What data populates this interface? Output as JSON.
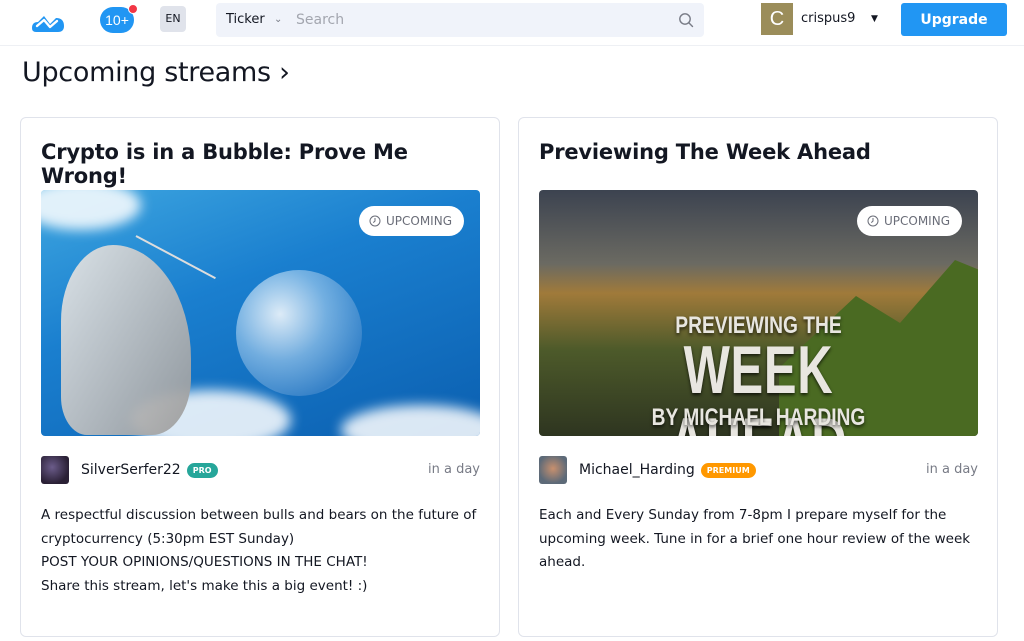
{
  "header": {
    "logo": "tradingview-cloud-logo",
    "notifications": {
      "count_label": "10+",
      "has_unread_dot": true
    },
    "language": "EN",
    "search": {
      "scope_label": "Ticker",
      "placeholder": "Search",
      "value": ""
    },
    "user": {
      "avatar_letter": "C",
      "username": "crispus9",
      "avatar_color": "#9b8d5a"
    },
    "upgrade_label": "Upgrade",
    "accent_color": "#2196f3"
  },
  "section": {
    "title": "Upcoming streams ›"
  },
  "streams": [
    {
      "title": "Crypto is in a Bubble: Prove Me Wrong!",
      "status": "UPCOMING",
      "thumbnail": "needle-popping-bubble-sky",
      "author": "SilverSerfer22",
      "tier": "PRO",
      "when": "in a day",
      "description": [
        "A respectful discussion between bulls and bears on the future of cryptocurrency (5:30pm EST Sunday)",
        "POST YOUR OPINIONS/QUESTIONS IN THE CHAT!",
        "Share this stream, let's make this a big event! :)"
      ]
    },
    {
      "title": "Previewing The Week Ahead",
      "status": "UPCOMING",
      "thumbnail": "mountain-landscape-title-card",
      "thumbnail_text": [
        "PREVIEWING THE",
        "WEEK AHEAD",
        "BY MICHAEL HARDING"
      ],
      "author": "Michael_Harding",
      "tier": "PREMIUM",
      "when": "in a day",
      "description": [
        "Each and Every Sunday from 7-8pm I prepare myself for the upcoming week. Tune in for a brief one hour review of the week ahead."
      ]
    }
  ]
}
